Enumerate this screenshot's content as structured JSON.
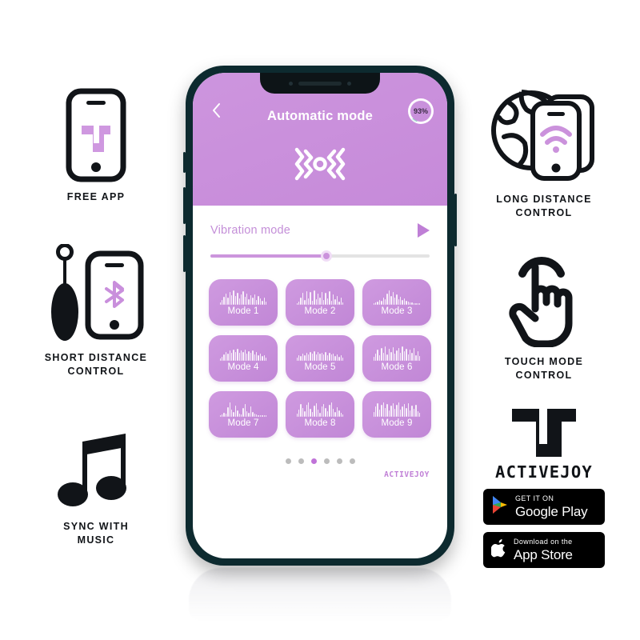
{
  "features": {
    "free_app": {
      "caption": "FREE APP",
      "icon": "phone-with-logo-icon"
    },
    "short_dist": {
      "caption": "SHORT DISTANCE\nCONTROL",
      "icon": "device-and-phone-bluetooth-icon"
    },
    "music": {
      "caption": "SYNC WITH\nMUSIC",
      "icon": "music-note-icon"
    },
    "long_dist": {
      "caption": "LONG DISTANCE\nCONTROL",
      "icon": "globe-phones-wifi-icon"
    },
    "touch": {
      "caption": "TOUCH MODE\nCONTROL",
      "icon": "tap-hand-icon"
    }
  },
  "brand": {
    "wordmark": "ACTIVEJOY",
    "logo_icon": "activejoy-monogram-icon",
    "google_play": {
      "small": "GET IT ON",
      "big": "Google Play",
      "icon": "google-play-icon"
    },
    "app_store": {
      "small": "Download on the",
      "big": "App Store",
      "icon": "apple-icon"
    }
  },
  "phone": {
    "header": {
      "back_icon": "chevron-left-icon",
      "title": "Automatic mode",
      "battery": "93%",
      "vibration_icon": "vibration-waves-icon"
    },
    "vibration": {
      "label": "Vibration mode",
      "play_icon": "play-icon",
      "slider_percent": 53
    },
    "modes": [
      {
        "label": "Mode 1",
        "wave": [
          3,
          6,
          10,
          14,
          9,
          16,
          12,
          18,
          11,
          15,
          8,
          13,
          17,
          10,
          14,
          7,
          12,
          9,
          13,
          6,
          11,
          8,
          5,
          9,
          4
        ]
      },
      {
        "label": "Mode 2",
        "wave": [
          2,
          4,
          9,
          15,
          6,
          17,
          8,
          16,
          5,
          18,
          7,
          14,
          9,
          16,
          6,
          15,
          8,
          17,
          5,
          13,
          7,
          11,
          4,
          9,
          3
        ]
      },
      {
        "label": "Mode 3",
        "wave": [
          2,
          3,
          4,
          6,
          5,
          9,
          7,
          14,
          18,
          11,
          16,
          9,
          13,
          7,
          10,
          6,
          8,
          5,
          4,
          3,
          3,
          2,
          2,
          2,
          2
        ]
      },
      {
        "label": "Mode 4",
        "wave": [
          3,
          5,
          8,
          11,
          9,
          13,
          10,
          14,
          11,
          15,
          10,
          13,
          11,
          14,
          9,
          12,
          10,
          13,
          8,
          11,
          7,
          9,
          6,
          7,
          4
        ]
      },
      {
        "label": "Mode 5",
        "wave": [
          4,
          7,
          6,
          9,
          7,
          10,
          8,
          11,
          9,
          12,
          8,
          11,
          9,
          10,
          8,
          11,
          7,
          10,
          8,
          9,
          6,
          8,
          5,
          7,
          4
        ]
      },
      {
        "label": "Mode 6",
        "wave": [
          5,
          9,
          14,
          7,
          16,
          10,
          18,
          8,
          15,
          11,
          17,
          9,
          13,
          16,
          10,
          18,
          12,
          15,
          8,
          14,
          10,
          16,
          7,
          12,
          6
        ]
      },
      {
        "label": "Mode 7",
        "wave": [
          2,
          3,
          5,
          4,
          12,
          18,
          9,
          6,
          14,
          8,
          4,
          3,
          11,
          16,
          7,
          5,
          13,
          6,
          4,
          3,
          2,
          2,
          2,
          2,
          2
        ]
      },
      {
        "label": "Mode 8",
        "wave": [
          4,
          9,
          16,
          11,
          7,
          15,
          18,
          10,
          6,
          14,
          17,
          9,
          5,
          13,
          16,
          11,
          7,
          15,
          18,
          10,
          6,
          12,
          8,
          5,
          3
        ]
      },
      {
        "label": "Mode 9",
        "wave": [
          6,
          13,
          17,
          9,
          15,
          18,
          11,
          16,
          8,
          14,
          17,
          10,
          15,
          18,
          9,
          13,
          16,
          11,
          17,
          8,
          14,
          10,
          15,
          7,
          5
        ]
      }
    ],
    "pagination": {
      "count": 6,
      "active_index": 2
    },
    "footer_logo": "ACTIVEJOY"
  },
  "colors": {
    "header_purple": "#c990dc",
    "tile_purple": "#c88ddb",
    "accent_purple": "#c07fd6",
    "frame_dark": "#0d2a2f",
    "dot_inactive": "#bcbcbc"
  }
}
